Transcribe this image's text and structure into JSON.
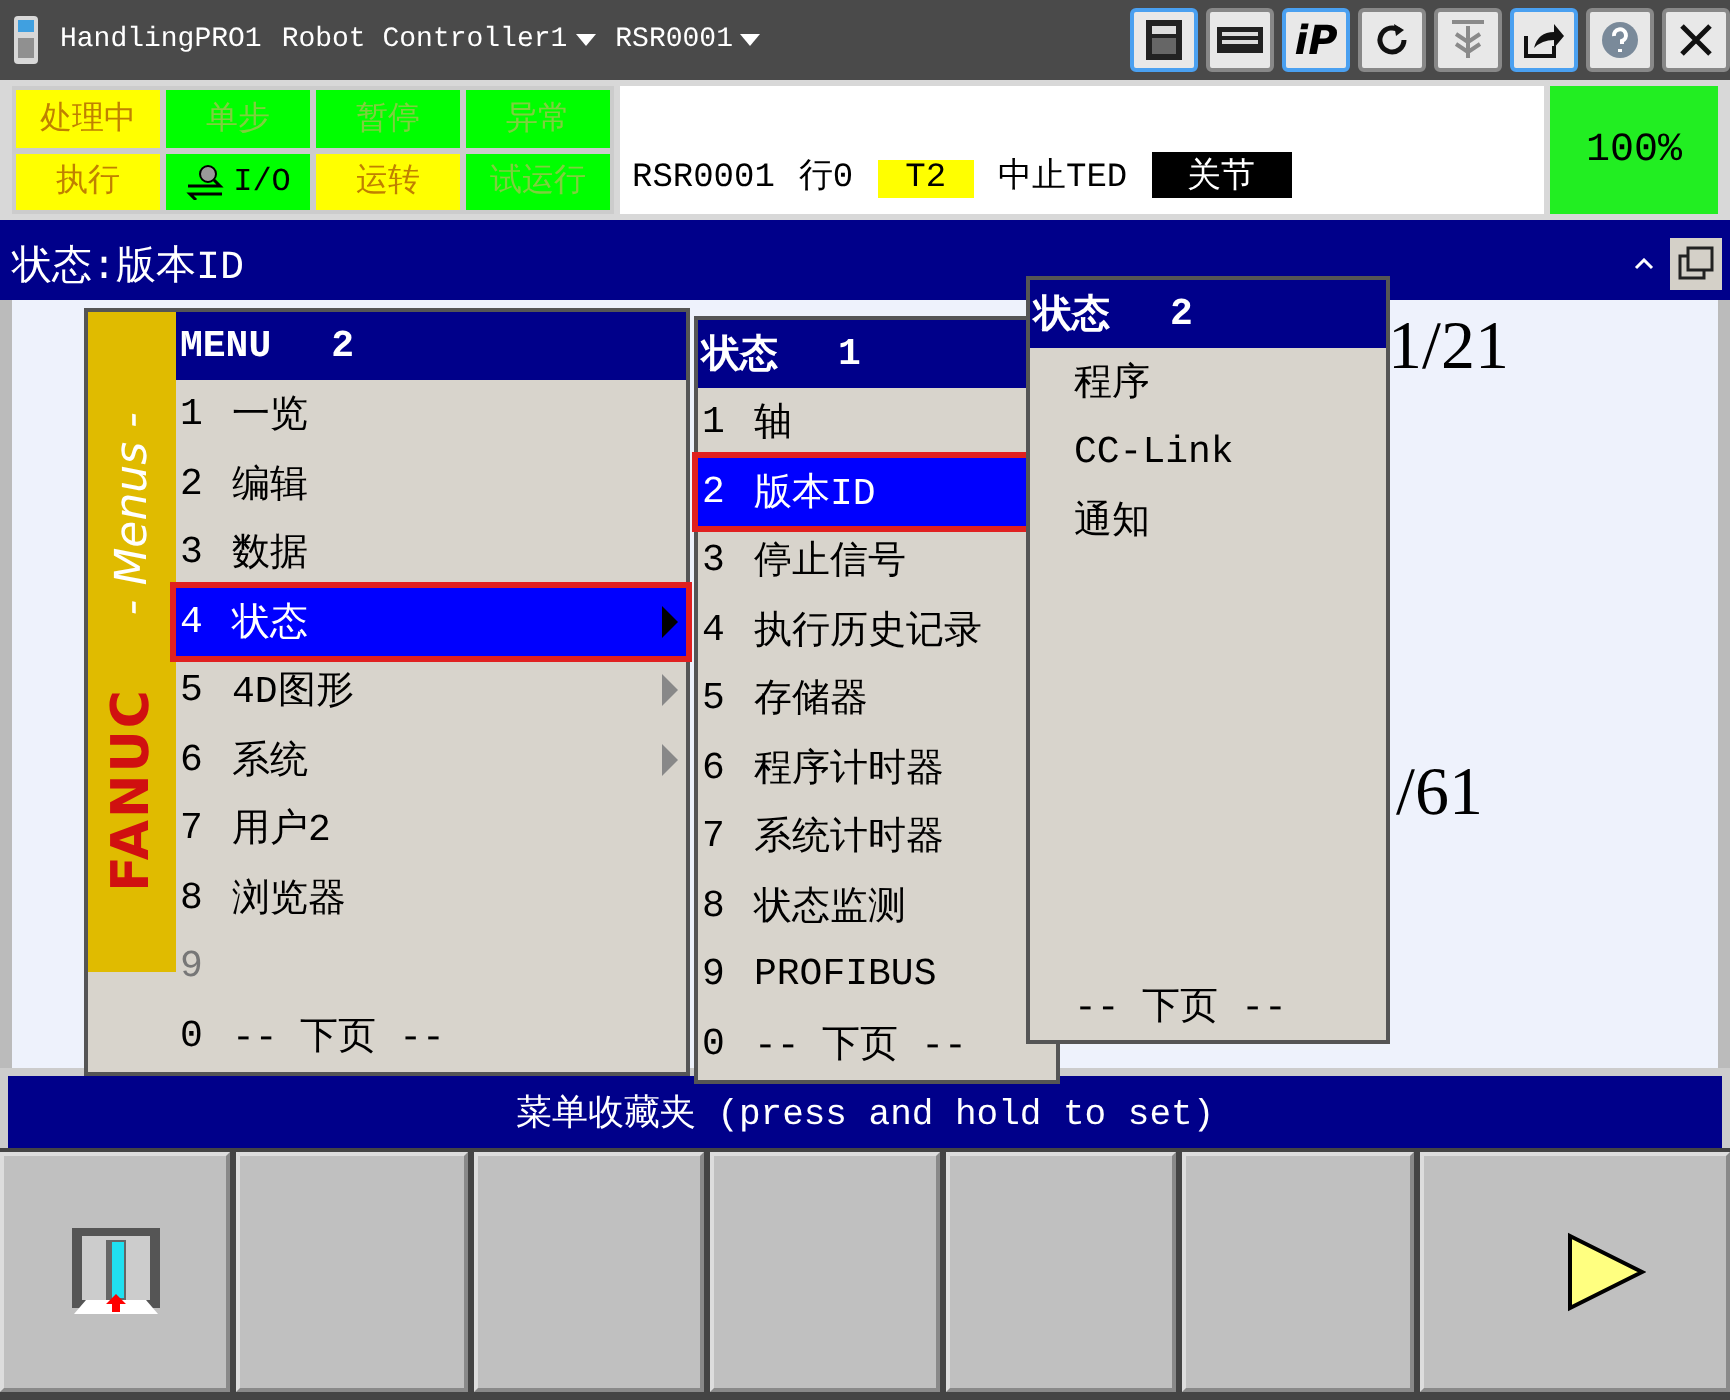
{
  "top_bar": {
    "app": "HandlingPRO1",
    "controller": "Robot Controller1",
    "program": "RSR0001"
  },
  "toolbar_buttons": [
    {
      "kind": "pendant",
      "highlighted": true
    },
    {
      "kind": "keyboard",
      "highlighted": false
    },
    {
      "kind": "ip",
      "label": "iP",
      "highlighted": true
    },
    {
      "kind": "refresh",
      "highlighted": false
    },
    {
      "kind": "stack",
      "highlighted": false
    },
    {
      "kind": "share",
      "highlighted": true
    },
    {
      "kind": "help",
      "highlighted": false
    },
    {
      "kind": "close",
      "highlighted": false
    }
  ],
  "status_indicators": [
    {
      "label": "处理中",
      "color": "#ffff00",
      "kind": "text"
    },
    {
      "label": "单步",
      "color": "#00ff00",
      "kind": "text"
    },
    {
      "label": "暂停",
      "color": "#00ff00",
      "kind": "text"
    },
    {
      "label": "异常",
      "color": "#00ff00",
      "kind": "text"
    },
    {
      "label": "执行",
      "color": "#ffff00",
      "kind": "text"
    },
    {
      "label": "I/O",
      "color": "#00ff00",
      "kind": "io"
    },
    {
      "label": "运转",
      "color": "#ffff00",
      "kind": "text"
    },
    {
      "label": "试运行",
      "color": "#00ff00",
      "kind": "text"
    }
  ],
  "info": {
    "program": "RSR0001",
    "line": "行0",
    "mode": "T2",
    "state": "中止TED",
    "coord": "关节"
  },
  "override": "100%",
  "screen_title": "状态:版本ID",
  "background_texts": [
    "1/21",
    "/61"
  ],
  "main_menu": {
    "caption": "- Menus -",
    "brand": "FANUC",
    "title": "MENU",
    "page": "2",
    "items": [
      {
        "number": "1",
        "label": "一览",
        "selected": false,
        "submenu": false,
        "disabled": false,
        "annotated": false
      },
      {
        "number": "2",
        "label": "编辑",
        "selected": false,
        "submenu": false,
        "disabled": false,
        "annotated": false
      },
      {
        "number": "3",
        "label": "数据",
        "selected": false,
        "submenu": false,
        "disabled": false,
        "annotated": false
      },
      {
        "number": "4",
        "label": "状态",
        "selected": true,
        "submenu": true,
        "disabled": false,
        "annotated": true
      },
      {
        "number": "5",
        "label": "4D图形",
        "selected": false,
        "submenu": true,
        "disabled": false,
        "annotated": false
      },
      {
        "number": "6",
        "label": "系统",
        "selected": false,
        "submenu": true,
        "disabled": false,
        "annotated": false
      },
      {
        "number": "7",
        "label": "用户2",
        "selected": false,
        "submenu": false,
        "disabled": false,
        "annotated": false
      },
      {
        "number": "8",
        "label": "浏览器",
        "selected": false,
        "submenu": false,
        "disabled": false,
        "annotated": false
      },
      {
        "number": "9",
        "selected": false,
        "submenu": false,
        "disabled": true,
        "annotated": false
      },
      {
        "number": "0",
        "label": "-- 下页 --",
        "selected": false,
        "submenu": false,
        "disabled": false,
        "annotated": false
      }
    ]
  },
  "status_menu_1": {
    "title": "状态",
    "page": "1",
    "items": [
      {
        "number": "1",
        "label": "轴",
        "selected": false,
        "annotated": false
      },
      {
        "number": "2",
        "label": "版本ID",
        "selected": true,
        "annotated": true
      },
      {
        "number": "3",
        "label": "停止信号",
        "selected": false,
        "annotated": false
      },
      {
        "number": "4",
        "label": "执行历史记录",
        "selected": false,
        "annotated": false
      },
      {
        "number": "5",
        "label": "存储器",
        "selected": false,
        "annotated": false
      },
      {
        "number": "6",
        "label": "程序计时器",
        "selected": false,
        "annotated": false
      },
      {
        "number": "7",
        "label": "系统计时器",
        "selected": false,
        "annotated": false
      },
      {
        "number": "8",
        "label": "状态监测",
        "selected": false,
        "annotated": false
      },
      {
        "number": "9",
        "label": "PROFIBUS",
        "selected": false,
        "annotated": false
      },
      {
        "number": "0",
        "label": "-- 下页 --",
        "selected": false,
        "annotated": false
      }
    ]
  },
  "status_menu_2": {
    "title": "状态",
    "page": "2",
    "items": [
      {
        "label": "程序"
      },
      {
        "label": "CC-Link"
      },
      {
        "label": "通知"
      }
    ],
    "footer": "-- 下页 --"
  },
  "favorites_bar": "菜单收藏夹 (press and hold to set)",
  "function_keys": [
    {
      "kind": "exit"
    },
    {
      "kind": "blank"
    },
    {
      "kind": "blank"
    },
    {
      "kind": "blank"
    },
    {
      "kind": "blank"
    },
    {
      "kind": "blank"
    },
    {
      "kind": "next"
    }
  ]
}
